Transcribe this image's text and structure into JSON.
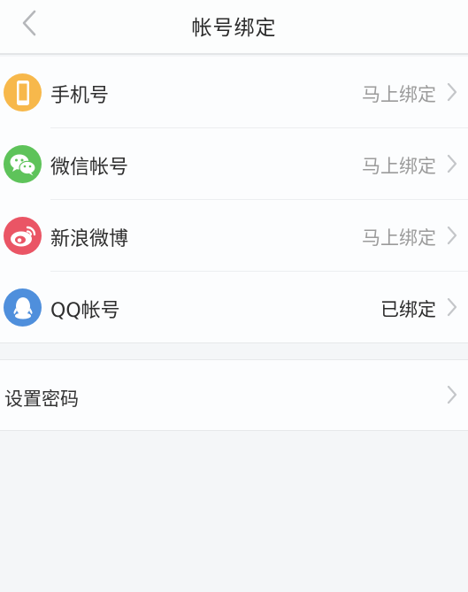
{
  "header": {
    "title": "帐号绑定",
    "back_icon": "chevron-left-icon"
  },
  "bindings": [
    {
      "label": "手机号",
      "status": "马上绑定",
      "icon": "phone-icon",
      "color": "#f7b84b"
    },
    {
      "label": "微信帐号",
      "status": "马上绑定",
      "icon": "wechat-icon",
      "color": "#5ec35a"
    },
    {
      "label": "新浪微博",
      "status": "马上绑定",
      "icon": "weibo-icon",
      "color": "#ea5565"
    },
    {
      "label": "QQ帐号",
      "status": "已绑定",
      "icon": "qq-icon",
      "color": "#4f8fdc"
    }
  ],
  "settings": {
    "set_password_label": "设置密码"
  }
}
